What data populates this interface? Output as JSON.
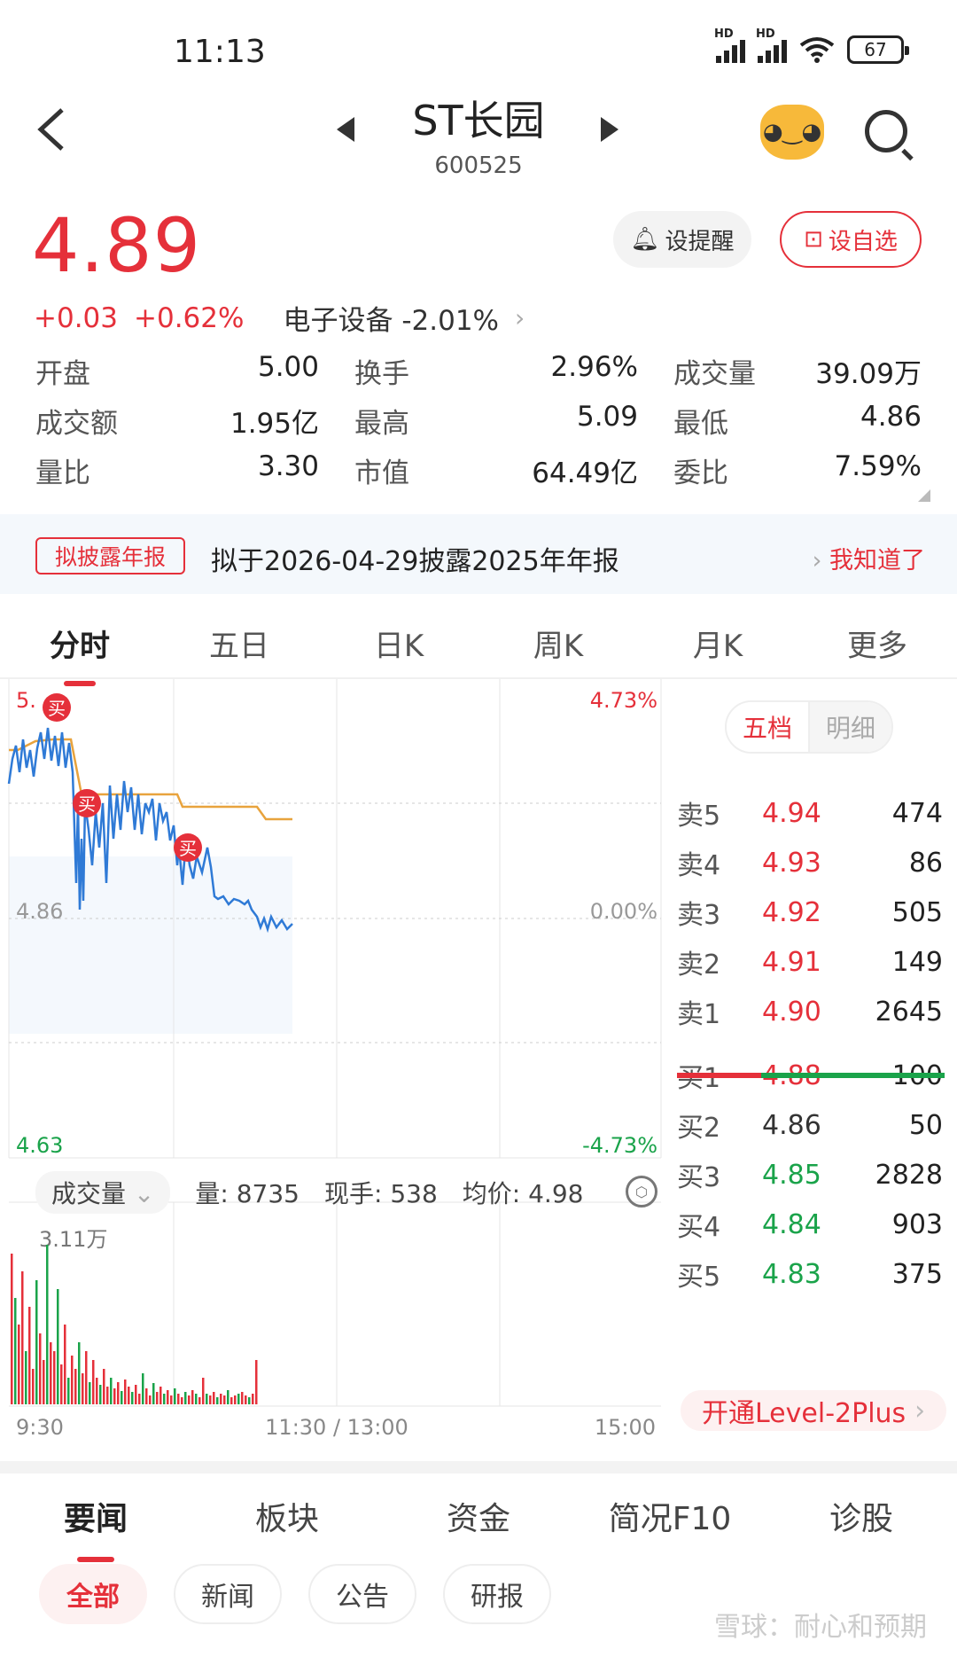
{
  "status": {
    "time": "11:13",
    "battery": "67",
    "hd1": "HD",
    "hd2": "HD"
  },
  "header": {
    "title": "ST长园",
    "code": "600525"
  },
  "quote": {
    "price": "4.89",
    "change": "+0.03",
    "change_pct": "+0.62%",
    "sector": "电子设备",
    "sector_pct": "-2.01%",
    "alert_label": "设提醒",
    "watch_label": "设自选"
  },
  "stats": [
    [
      {
        "label": "开盘",
        "value": "5.00",
        "color": "red"
      },
      {
        "label": "换手",
        "value": "2.96%",
        "color": "black"
      },
      {
        "label": "成交量",
        "value": "39.09万",
        "color": "black"
      }
    ],
    [
      {
        "label": "成交额",
        "value": "1.95亿",
        "color": "black"
      },
      {
        "label": "最高",
        "value": "5.09",
        "color": "red"
      },
      {
        "label": "最低",
        "value": "4.86",
        "color": "black"
      }
    ],
    [
      {
        "label": "量比",
        "value": "3.30",
        "color": "black"
      },
      {
        "label": "市值",
        "value": "64.49亿",
        "color": "black"
      },
      {
        "label": "委比",
        "value": "7.59%",
        "color": "red"
      }
    ]
  ],
  "notice": {
    "tag": "拟披露年报",
    "text": "拟于2026-04-29披露2025年年报",
    "ack": "我知道了"
  },
  "chart_tabs": [
    "分时",
    "五日",
    "日K",
    "周K",
    "月K",
    "更多"
  ],
  "chart": {
    "y_top": "5.",
    "y_mid": "4.86",
    "y_bottom": "4.63",
    "pct_top": "4.73%",
    "pct_mid": "0.00%",
    "pct_bottom": "-4.73%",
    "buy_marker": "买",
    "time_start": "9:30",
    "time_mid": "11:30 / 13:00",
    "time_end": "15:00"
  },
  "volume_bar": {
    "select": "成交量",
    "vol": "量: 8735",
    "now": "现手: 538",
    "avg": "均价: 4.98",
    "max_label": "3.11万"
  },
  "orderbook": {
    "toggle_on": "五档",
    "toggle_off": "明细",
    "rows": [
      {
        "label": "卖5",
        "price": "4.94",
        "vol": "474",
        "color": "red"
      },
      {
        "label": "卖4",
        "price": "4.93",
        "vol": "86",
        "color": "red"
      },
      {
        "label": "卖3",
        "price": "4.92",
        "vol": "505",
        "color": "red"
      },
      {
        "label": "卖2",
        "price": "4.91",
        "vol": "149",
        "color": "red"
      },
      {
        "label": "卖1",
        "price": "4.90",
        "vol": "2645",
        "color": "red"
      },
      {
        "label": "买1",
        "price": "4.88",
        "vol": "100",
        "color": "red"
      },
      {
        "label": "买2",
        "price": "4.86",
        "vol": "50",
        "color": "black"
      },
      {
        "label": "买3",
        "price": "4.85",
        "vol": "2828",
        "color": "green"
      },
      {
        "label": "买4",
        "price": "4.84",
        "vol": "903",
        "color": "green"
      },
      {
        "label": "买5",
        "price": "4.83",
        "vol": "375",
        "color": "green"
      }
    ],
    "level2": "开通Level-2Plus"
  },
  "news_tabs": [
    "要闻",
    "板块",
    "资金",
    "简况F10",
    "诊股"
  ],
  "chips": [
    "全部",
    "新闻",
    "公告",
    "研报"
  ],
  "watermark": "雪球：耐心和预期",
  "colors": {
    "red": "#e5303a",
    "green": "#1aa34a",
    "avg_line": "#e8a33d",
    "price_line": "#2f7ad6"
  }
}
